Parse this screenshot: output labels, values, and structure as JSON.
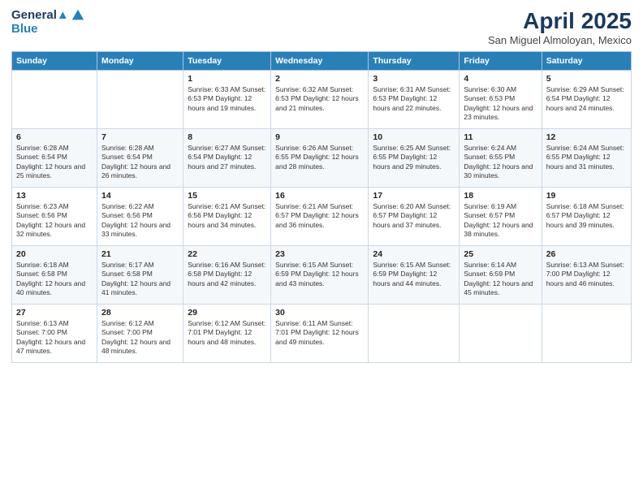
{
  "logo": {
    "line1": "General",
    "line2": "Blue"
  },
  "title": "April 2025",
  "subtitle": "San Miguel Almoloyan, Mexico",
  "days_header": [
    "Sunday",
    "Monday",
    "Tuesday",
    "Wednesday",
    "Thursday",
    "Friday",
    "Saturday"
  ],
  "weeks": [
    [
      {
        "day": "",
        "info": ""
      },
      {
        "day": "",
        "info": ""
      },
      {
        "day": "1",
        "info": "Sunrise: 6:33 AM\nSunset: 6:53 PM\nDaylight: 12 hours and 19 minutes."
      },
      {
        "day": "2",
        "info": "Sunrise: 6:32 AM\nSunset: 6:53 PM\nDaylight: 12 hours and 21 minutes."
      },
      {
        "day": "3",
        "info": "Sunrise: 6:31 AM\nSunset: 6:53 PM\nDaylight: 12 hours and 22 minutes."
      },
      {
        "day": "4",
        "info": "Sunrise: 6:30 AM\nSunset: 6:53 PM\nDaylight: 12 hours and 23 minutes."
      },
      {
        "day": "5",
        "info": "Sunrise: 6:29 AM\nSunset: 6:54 PM\nDaylight: 12 hours and 24 minutes."
      }
    ],
    [
      {
        "day": "6",
        "info": "Sunrise: 6:28 AM\nSunset: 6:54 PM\nDaylight: 12 hours and 25 minutes."
      },
      {
        "day": "7",
        "info": "Sunrise: 6:28 AM\nSunset: 6:54 PM\nDaylight: 12 hours and 26 minutes."
      },
      {
        "day": "8",
        "info": "Sunrise: 6:27 AM\nSunset: 6:54 PM\nDaylight: 12 hours and 27 minutes."
      },
      {
        "day": "9",
        "info": "Sunrise: 6:26 AM\nSunset: 6:55 PM\nDaylight: 12 hours and 28 minutes."
      },
      {
        "day": "10",
        "info": "Sunrise: 6:25 AM\nSunset: 6:55 PM\nDaylight: 12 hours and 29 minutes."
      },
      {
        "day": "11",
        "info": "Sunrise: 6:24 AM\nSunset: 6:55 PM\nDaylight: 12 hours and 30 minutes."
      },
      {
        "day": "12",
        "info": "Sunrise: 6:24 AM\nSunset: 6:55 PM\nDaylight: 12 hours and 31 minutes."
      }
    ],
    [
      {
        "day": "13",
        "info": "Sunrise: 6:23 AM\nSunset: 6:56 PM\nDaylight: 12 hours and 32 minutes."
      },
      {
        "day": "14",
        "info": "Sunrise: 6:22 AM\nSunset: 6:56 PM\nDaylight: 12 hours and 33 minutes."
      },
      {
        "day": "15",
        "info": "Sunrise: 6:21 AM\nSunset: 6:56 PM\nDaylight: 12 hours and 34 minutes."
      },
      {
        "day": "16",
        "info": "Sunrise: 6:21 AM\nSunset: 6:57 PM\nDaylight: 12 hours and 36 minutes."
      },
      {
        "day": "17",
        "info": "Sunrise: 6:20 AM\nSunset: 6:57 PM\nDaylight: 12 hours and 37 minutes."
      },
      {
        "day": "18",
        "info": "Sunrise: 6:19 AM\nSunset: 6:57 PM\nDaylight: 12 hours and 38 minutes."
      },
      {
        "day": "19",
        "info": "Sunrise: 6:18 AM\nSunset: 6:57 PM\nDaylight: 12 hours and 39 minutes."
      }
    ],
    [
      {
        "day": "20",
        "info": "Sunrise: 6:18 AM\nSunset: 6:58 PM\nDaylight: 12 hours and 40 minutes."
      },
      {
        "day": "21",
        "info": "Sunrise: 6:17 AM\nSunset: 6:58 PM\nDaylight: 12 hours and 41 minutes."
      },
      {
        "day": "22",
        "info": "Sunrise: 6:16 AM\nSunset: 6:58 PM\nDaylight: 12 hours and 42 minutes."
      },
      {
        "day": "23",
        "info": "Sunrise: 6:15 AM\nSunset: 6:59 PM\nDaylight: 12 hours and 43 minutes."
      },
      {
        "day": "24",
        "info": "Sunrise: 6:15 AM\nSunset: 6:59 PM\nDaylight: 12 hours and 44 minutes."
      },
      {
        "day": "25",
        "info": "Sunrise: 6:14 AM\nSunset: 6:59 PM\nDaylight: 12 hours and 45 minutes."
      },
      {
        "day": "26",
        "info": "Sunrise: 6:13 AM\nSunset: 7:00 PM\nDaylight: 12 hours and 46 minutes."
      }
    ],
    [
      {
        "day": "27",
        "info": "Sunrise: 6:13 AM\nSunset: 7:00 PM\nDaylight: 12 hours and 47 minutes."
      },
      {
        "day": "28",
        "info": "Sunrise: 6:12 AM\nSunset: 7:00 PM\nDaylight: 12 hours and 48 minutes."
      },
      {
        "day": "29",
        "info": "Sunrise: 6:12 AM\nSunset: 7:01 PM\nDaylight: 12 hours and 48 minutes."
      },
      {
        "day": "30",
        "info": "Sunrise: 6:11 AM\nSunset: 7:01 PM\nDaylight: 12 hours and 49 minutes."
      },
      {
        "day": "",
        "info": ""
      },
      {
        "day": "",
        "info": ""
      },
      {
        "day": "",
        "info": ""
      }
    ]
  ]
}
